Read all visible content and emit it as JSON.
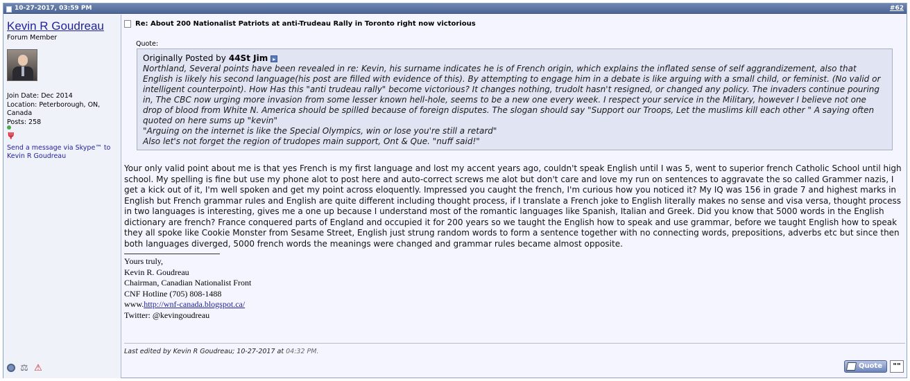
{
  "header": {
    "date": "10-27-2017, 03:59 PM",
    "post_number": "#62"
  },
  "user": {
    "name": "Kevin R Goudreau",
    "title": "Forum Member",
    "join_date": "Join Date: Dec 2014",
    "location": "Location: Peterborough, ON, Canada",
    "posts": "Posts: 258",
    "skype_link": "Send a message via Skype™ to Kevin R Goudreau",
    "icons": [
      "status-icon",
      "reputation-icon",
      "report-icon"
    ]
  },
  "post": {
    "title": "Re: About 200 Nationalist Patriots at anti-Trudeau Rally in Toronto right now victorious",
    "quote_label": "Quote:",
    "quote_prefix": "Originally Posted by",
    "quote_author": "44St Jim",
    "quote_lines": [
      "Northland, Several points have been revealed in re: Kevin, his surname indicates he is of French origin, which explains the inflated sense of self aggrandizement, also that English is likely his second language(his post are filled with evidence of this). By attempting to engage him in a debate is like arguing with a small child, or feminist. (No valid or intelligent counterpoint). How Has this \"anti trudeau rally\" become victorious? It changes nothing, trudolt hasn't resigned, or changed any policy. The invaders continue pouring in, The CBC now urging more invasion from some lesser known hell-hole, seems to be a new one every week. I respect your service in the Military, however I believe not one drop of blood from White N. America should be spilled because of foreign disputes. The slogan should say \"Support our Troops, Let the muslims kill each other \" A saying often quoted on here sums up \"kevin\"",
      "\"Arguing on the internet is like the Special Olympics, win or lose you're still a retard\"",
      "Also let's not forget the region of trudopes main support, Ont & Que. \"nuff said!\""
    ],
    "body": "Your only valid point about me is that yes French is my first language and lost my accent years ago, couldn't speak English until I was 5, went to superior french Catholic School until high school. My spelling is fine but use my phone alot to post here and auto-correct screws me alot but don't care and love my run on sentences to aggravate the so called Grammer nazis, I get a kick out of it, I'm well spoken and get my point across eloquently. Impressed you caught the french, I'm curious how you noticed it? My IQ was 156 in grade 7 and highest marks in English but French grammar rules and English are quite different including thought process, if I translate a French joke to English literally makes no sense and visa versa, thought process in two languages is interesting, gives me a one up because I understand most of the romantic languages like Spanish, Italian and Greek. Did you know that 5000 words in the English dictionary are french? France conquered parts of England and occupied it for 200 years so we taught the English how to speak and use grammar, before we taught English how to speak they all spoke like Cookie Monster from Sesame Street, English just strung random words to form a sentence together with no connecting words, prepositions, adverbs etc but since then both languages diverged, 5000 french words the meanings were changed and grammar rules became almost opposite.",
    "signature": {
      "line1": "Yours truly,",
      "line2": "Kevin R. Goudreau",
      "line3": "Chairman, Canadian Nationalist Front",
      "line4": "CNF Hotline (705) 808-1488",
      "www_prefix": "www.",
      "link": "http://wnf-canada.blogspot.ca/",
      "twitter": "Twitter: @kevingoudreau"
    },
    "edit_note": "Last edited by Kevin R Goudreau; 10-27-2017 at",
    "edit_time": "04:32 PM.",
    "quote_button": "Quote",
    "multiquote_button": "\"\""
  }
}
